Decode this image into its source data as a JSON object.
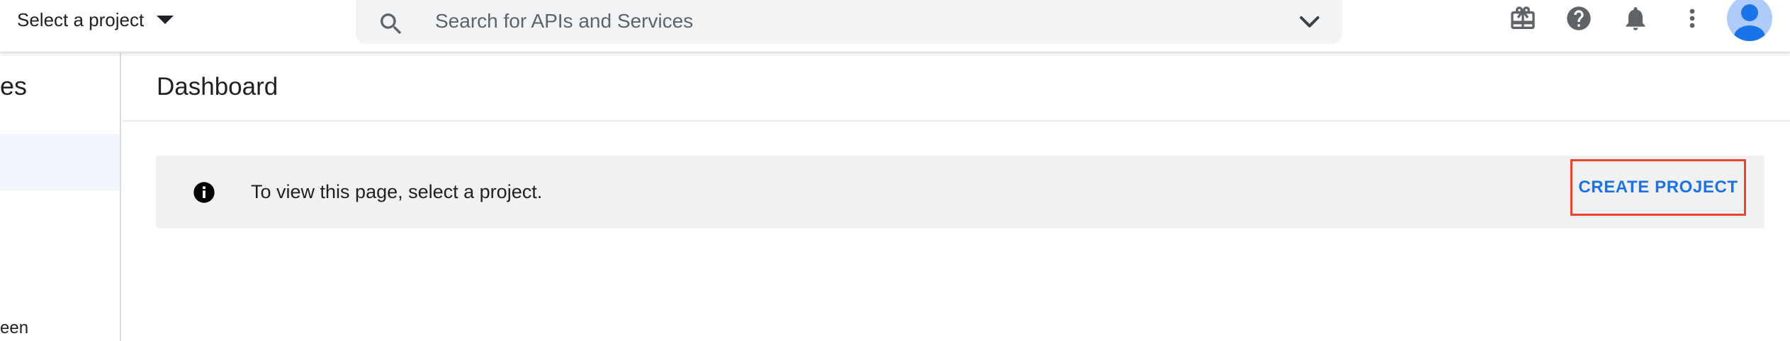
{
  "topbar": {
    "project_picker_label": "Select a project",
    "search": {
      "placeholder": "Search for APIs and Services",
      "value": ""
    },
    "icons": [
      "gift-icon",
      "help-icon",
      "notifications-icon",
      "more-vert-icon",
      "avatar"
    ]
  },
  "sidebar": {
    "title_fragment": "es",
    "bottom_item_fragment": "een"
  },
  "main": {
    "page_title": "Dashboard",
    "notice": {
      "text": "To view this page, select a project.",
      "button_label": "CREATE PROJECT"
    }
  },
  "colors": {
    "accent": "#1a73e8",
    "highlight_border": "#e8452c",
    "notice_background": "#f1f1f1",
    "search_background": "#f1f3f4",
    "selected_nav_background": "#f1f5fe",
    "icon_color": "#5f6368"
  }
}
